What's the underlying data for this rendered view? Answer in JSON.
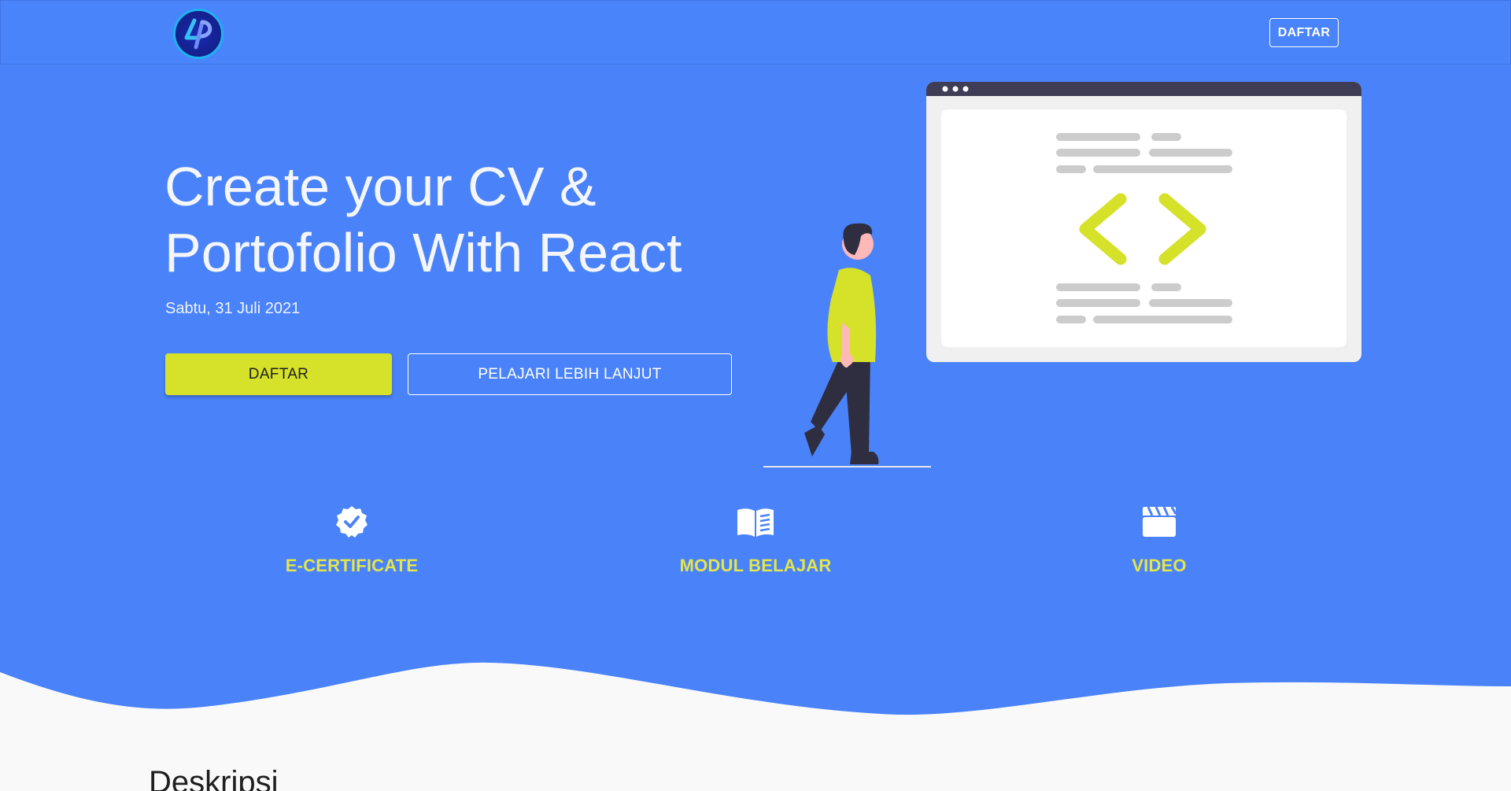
{
  "header": {
    "logo_icon": "lp-logo-icon",
    "register_label": "DAFTAR"
  },
  "hero": {
    "title_line1": "Create your CV &",
    "title_line2": "Portofolio With React",
    "date": "Sabtu, 31 Juli 2021",
    "primary_button": "DAFTAR",
    "secondary_button": "PELAJARI LEBIH LANJUT"
  },
  "features": [
    {
      "icon": "certificate-check-icon",
      "label": "E-CERTIFICATE"
    },
    {
      "icon": "book-open-icon",
      "label": "MODUL BELAJAR"
    },
    {
      "icon": "video-clapper-icon",
      "label": "VIDEO"
    }
  ],
  "section": {
    "title": "Deskripsi"
  },
  "colors": {
    "hero_background": "#4a83f9",
    "accent": "#d6e12a",
    "feature_label": "#e3e54a",
    "page_background": "#f9f9f9"
  }
}
